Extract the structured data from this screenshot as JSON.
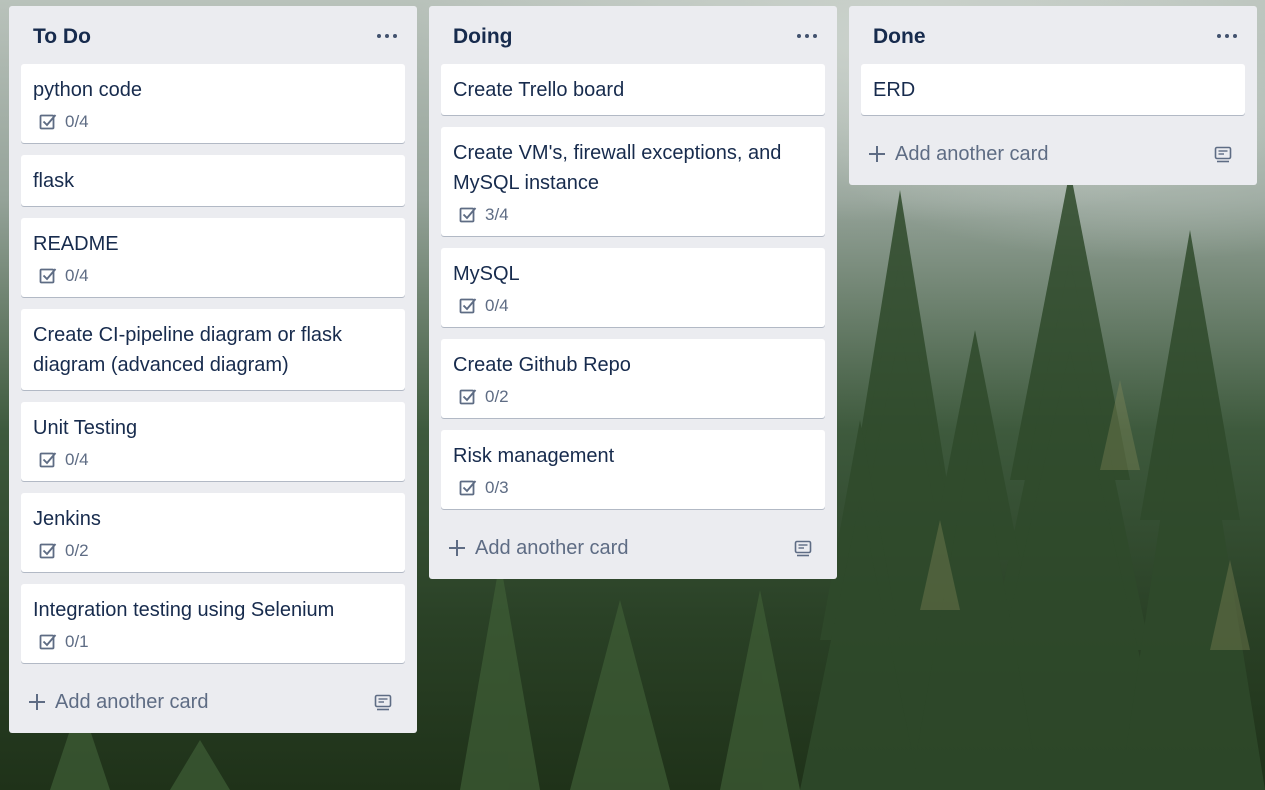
{
  "lists": [
    {
      "title": "To Do",
      "cards": [
        {
          "title": "python code",
          "checklist": "0/4"
        },
        {
          "title": "flask"
        },
        {
          "title": "README",
          "checklist": "0/4"
        },
        {
          "title": "Create CI-pipeline diagram or flask diagram (advanced diagram)"
        },
        {
          "title": "Unit Testing",
          "checklist": "0/4"
        },
        {
          "title": "Jenkins",
          "checklist": "0/2"
        },
        {
          "title": "Integration testing using Selenium",
          "checklist": "0/1"
        }
      ],
      "add_label": "Add another card"
    },
    {
      "title": "Doing",
      "cards": [
        {
          "title": "Create Trello board"
        },
        {
          "title": "Create VM's, firewall exceptions, and MySQL instance",
          "checklist": "3/4"
        },
        {
          "title": "MySQL",
          "checklist": "0/4"
        },
        {
          "title": "Create Github Repo",
          "checklist": "0/2"
        },
        {
          "title": "Risk management",
          "checklist": "0/3"
        }
      ],
      "add_label": "Add another card"
    },
    {
      "title": "Done",
      "cards": [
        {
          "title": "ERD"
        }
      ],
      "add_label": "Add another card"
    }
  ],
  "icons": {
    "list_menu": "more-horizontal-icon",
    "checklist": "checklist-icon",
    "add": "plus-icon",
    "template": "card-template-icon"
  },
  "colors": {
    "list_bg": "#ebecf0",
    "card_bg": "#ffffff",
    "text": "#172b4d",
    "muted": "#5e6c84"
  }
}
